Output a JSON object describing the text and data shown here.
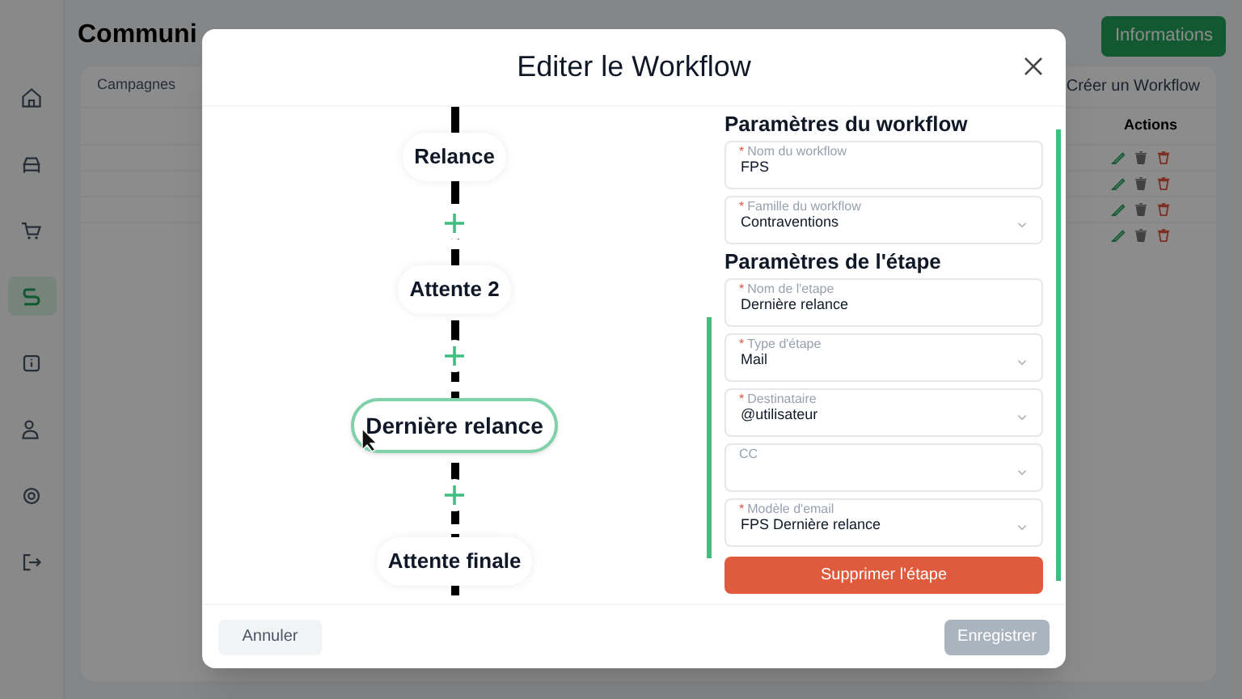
{
  "page": {
    "title": "Communi",
    "info_button": "Informations",
    "tabs": [
      {
        "label": "Campagnes",
        "selected": false
      }
    ],
    "create_button": "Créer un Workflow",
    "actions_header": "Actions"
  },
  "sidebar": {
    "items": [
      {
        "selected": false
      },
      {
        "selected": false
      },
      {
        "selected": false
      },
      {
        "selected": true
      },
      {
        "selected": false
      },
      {
        "selected": false
      },
      {
        "selected": false
      },
      {
        "selected": false
      }
    ]
  },
  "modal": {
    "title": "Editer le Workflow",
    "steps": [
      {
        "label": "Relance",
        "selected": false
      },
      {
        "label": "Attente 2",
        "selected": false
      },
      {
        "label": "Dernière relance",
        "selected": true
      },
      {
        "label": "Attente finale",
        "selected": false
      }
    ],
    "sections": [
      {
        "title": "Paramètres du workflow",
        "fields": [
          {
            "label": "Nom du workflow",
            "required_mark": "*",
            "kind": "input",
            "value": "FPS"
          },
          {
            "label": "Famille du workflow",
            "required_mark": "*",
            "kind": "select",
            "value": "Contraventions"
          }
        ]
      },
      {
        "title": "Paramètres de l'étape",
        "fields": [
          {
            "label": "Nom de l'etape",
            "required_mark": "*",
            "kind": "input",
            "value": "Dernière relance"
          },
          {
            "label": "Type d'étape",
            "required_mark": "*",
            "kind": "select",
            "value": "Mail"
          },
          {
            "label": "Destinataire",
            "required_mark": "*",
            "kind": "select",
            "value": "@utilisateur"
          },
          {
            "label": "CC",
            "kind": "select"
          },
          {
            "label": "Modèle d'email",
            "required_mark": "*",
            "kind": "select",
            "value": "FPS Dernière relance"
          }
        ]
      }
    ],
    "delete_button": "Supprimer l'étape",
    "cancel_button": "Annuler",
    "save_button": "Enregistrer",
    "save_disabled": true
  }
}
